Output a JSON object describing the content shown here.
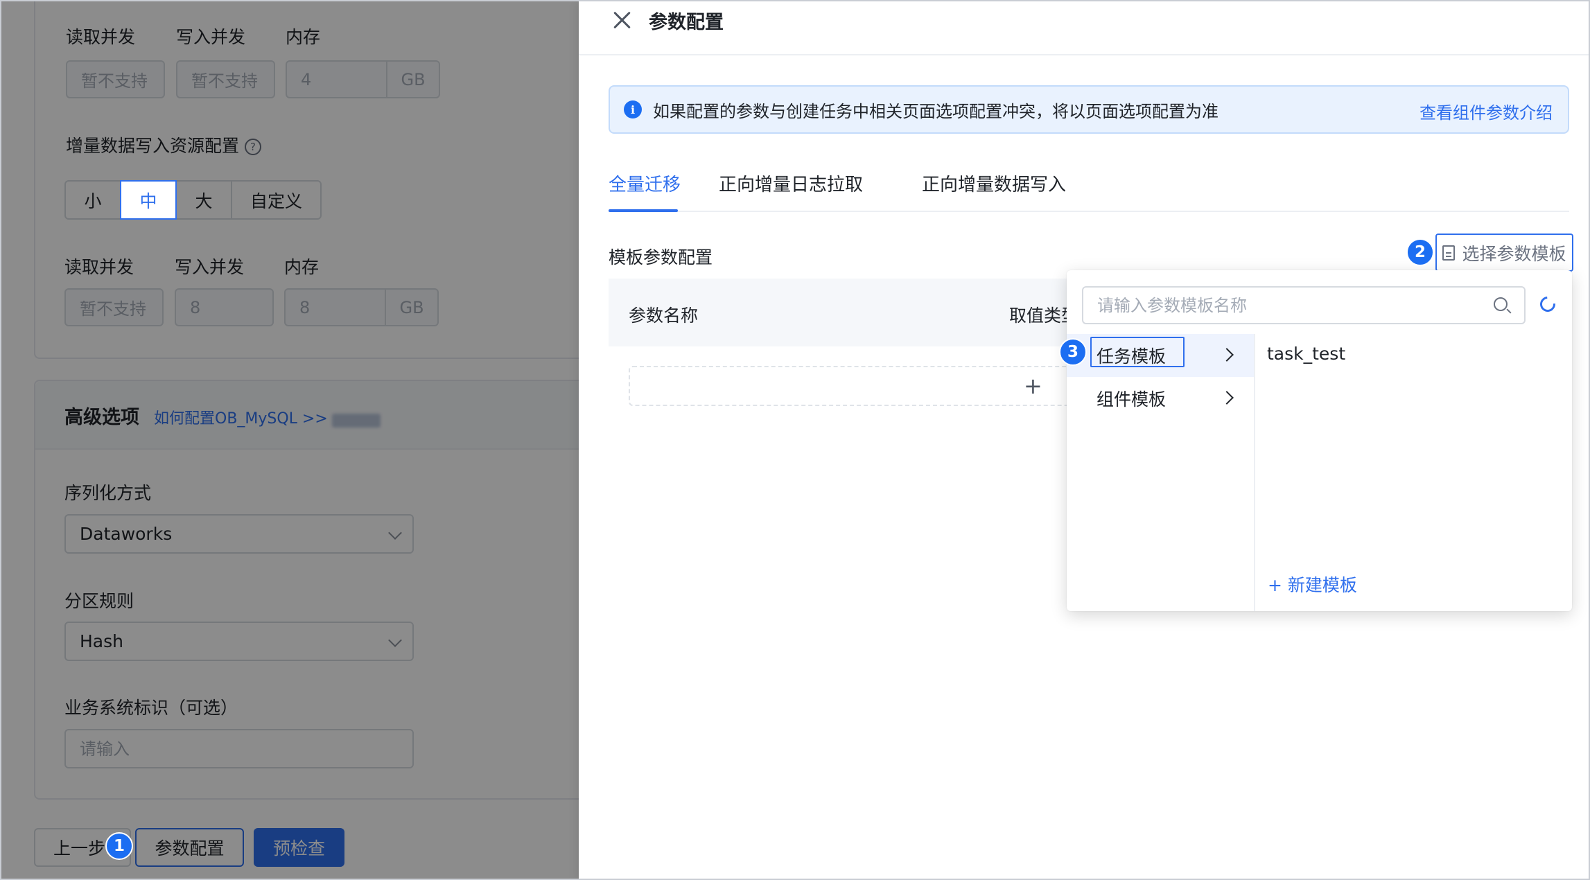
{
  "left_form": {
    "concurrency_labels": {
      "read": "读取并发",
      "write": "写入并发",
      "memory": "内存"
    },
    "row1": {
      "read_value": "暂不支持",
      "write_value": "暂不支持",
      "memory_value": "4",
      "memory_unit": "GB"
    },
    "incremental_resource": {
      "label": "增量数据写入资源配置",
      "help": "?",
      "options": [
        "小",
        "中",
        "大",
        "自定义"
      ],
      "selected": "中"
    },
    "row2": {
      "read_value": "暂不支持",
      "write_value": "8",
      "memory_value": "8",
      "memory_unit": "GB"
    },
    "advanced": {
      "title": "高级选项",
      "link_text": "如何配置OB_MySQL >>",
      "serialization_label": "序列化方式",
      "serialization_value": "Dataworks",
      "partition_label": "分区规则",
      "partition_value": "Hash",
      "biz_label": "业务系统标识（可选）",
      "biz_placeholder": "请输入"
    },
    "footer": {
      "prev": "上一步",
      "param_config": "参数配置",
      "precheck": "预检查"
    }
  },
  "badges": [
    "1",
    "2",
    "3"
  ],
  "drawer": {
    "title": "参数配置",
    "alert_text": "如果配置的参数与创建任务中相关页面选项配置冲突，将以页面选项配置为准",
    "alert_link": "查看组件参数介绍",
    "tabs": [
      "全量迁移",
      "正向增量日志拉取",
      "正向增量数据写入"
    ],
    "active_tab": "全量迁移",
    "section_title": "模板参数配置",
    "select_template_btn": "选择参数模板",
    "table_headers": {
      "name": "参数名称",
      "value_type": "取值类型"
    },
    "add_icon": "+"
  },
  "popover": {
    "search_placeholder": "请输入参数模板名称",
    "categories": [
      "任务模板",
      "组件模板"
    ],
    "active_category": "任务模板",
    "templates": [
      "task_test"
    ],
    "new_template": "+ 新建模板"
  },
  "colors": {
    "primary": "#2f6fed",
    "badge": "#1c6ef2",
    "alert_bg": "#e9f2fe"
  }
}
